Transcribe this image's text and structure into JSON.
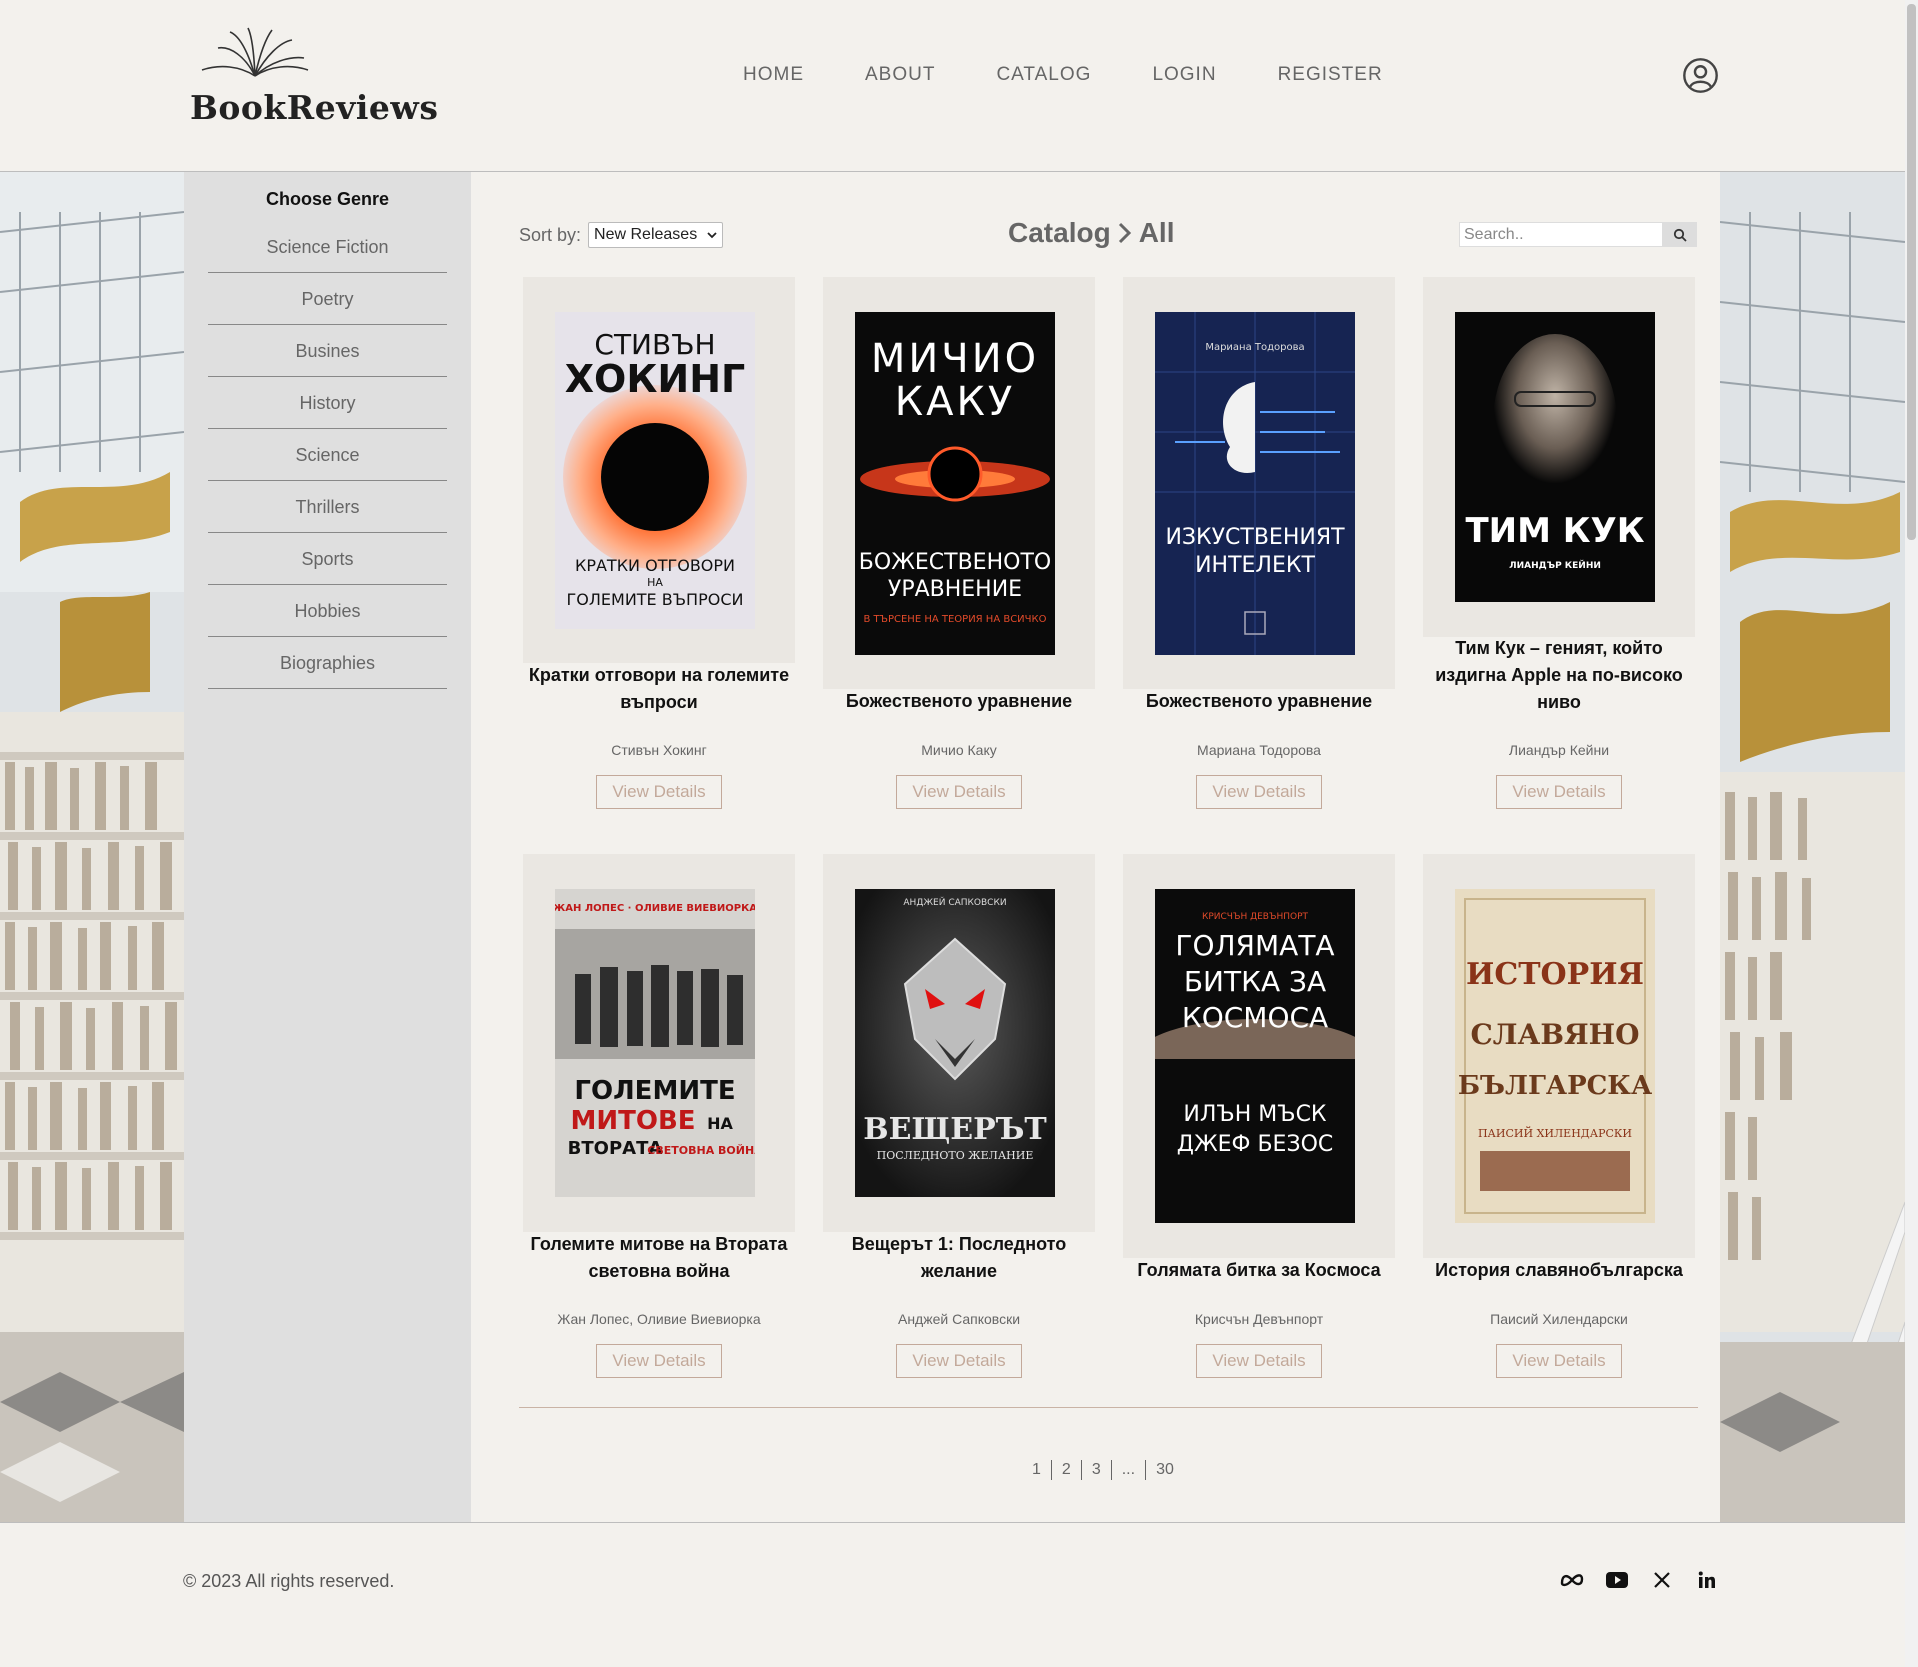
{
  "header": {
    "logo_text": "BookReviews",
    "nav": [
      "HOME",
      "ABOUT",
      "CATALOG",
      "LOGIN",
      "REGISTER"
    ]
  },
  "sidebar": {
    "title": "Choose Genre",
    "genres": [
      "Science Fiction",
      "Poetry",
      "Busines",
      "History",
      "Science",
      "Thrillers",
      "Sports",
      "Hobbies",
      "Biographies"
    ]
  },
  "toolbar": {
    "sort_label": "Sort by:",
    "sort_value": "New Releases",
    "catalog": "Catalog",
    "section": "All",
    "search_placeholder": "Search.."
  },
  "books": [
    {
      "title": "Кратки отговори на големите въпроси",
      "author": "Стивън Хокинг",
      "button": "View Details",
      "cover_text": [
        "СТИВЪН",
        "ХОКИНГ",
        "КРАТКИ ОТГОВОРИ",
        "НА",
        "ГОЛЕМИТЕ ВЪПРОСИ"
      ]
    },
    {
      "title": "Божественото уравнение",
      "author": "Мичио Каку",
      "button": "View Details",
      "cover_text": [
        "МИЧИО",
        "КАКУ",
        "БОЖЕСТВЕНОТО",
        "УРАВНЕНИЕ",
        "В ТЪРСЕНЕ НА ТЕОРИЯ НА ВСИЧКО"
      ]
    },
    {
      "title": "Божественото уравнение",
      "author": "Мариана Тодорова",
      "button": "View Details",
      "cover_text": [
        "Мариана Тодорова",
        "ИЗКУСТВЕНИЯТ",
        "ИНТЕЛЕКТ"
      ]
    },
    {
      "title": "Тим Кук – геният, който издигна Apple на по-високо ниво",
      "author": "Лиандър Кейни",
      "button": "View Details",
      "cover_text": [
        "ТИМ КУК",
        "ЛИАНДЪР КЕЙНИ"
      ]
    },
    {
      "title": "Големите митове на Втората световна война",
      "author": "Жан Лопес, Оливие Виевиорка",
      "button": "View Details",
      "cover_text": [
        "ГОЛЕМИТЕ",
        "МИТОВЕ",
        "НА",
        "ВТОРАТА",
        "СВЕТОВНА ВОЙНА"
      ]
    },
    {
      "title": "Вещерът 1: Последното желание",
      "author": "Анджей Сапковски",
      "button": "View Details",
      "cover_text": [
        "АНДЖЕЙ САПКОВСКИ",
        "ВЕЩЕРЪТ",
        "ПОСЛЕДНОТО ЖЕЛАНИЕ"
      ]
    },
    {
      "title": "Голямата битка за Космоса",
      "author": "Крисчън Девънпорт",
      "button": "View Details",
      "cover_text": [
        "КРИСЧЪН ДЕВЪНПОРТ",
        "ГОЛЯМАТА",
        "БИТКА ЗА",
        "КОСМОСА",
        "ИЛЪН МЪСК",
        "ДЖЕФ БЕЗОС"
      ]
    },
    {
      "title": "История славянобългарска",
      "author": "Паисий Хилендарски",
      "button": "View Details",
      "cover_text": [
        "ИСТОРИЯ",
        "СЛАВЯНО",
        "БЪЛГАРСКА",
        "ПАИСИЙ ХИЛЕНДАРСКИ"
      ]
    }
  ],
  "pagination": [
    "1",
    "2",
    "3",
    "...",
    "30"
  ],
  "footer": {
    "copyright": "© 2023 All rights reserved.",
    "socials": [
      "meta-icon",
      "youtube-icon",
      "x-icon",
      "linkedin-icon"
    ]
  }
}
